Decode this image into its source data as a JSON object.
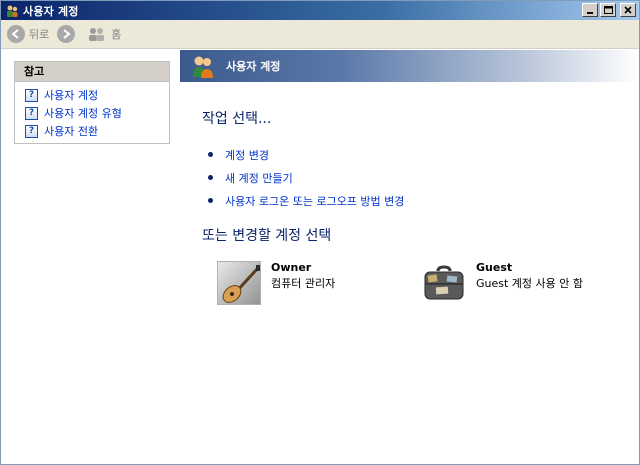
{
  "window": {
    "title": "사용자 계정"
  },
  "toolbar": {
    "back_label": "뒤로",
    "home_label": "홈"
  },
  "sidebar": {
    "panel_title": "참고",
    "links": [
      {
        "label": "사용자 계정"
      },
      {
        "label": "사용자 계정 유형"
      },
      {
        "label": "사용자 전환"
      }
    ]
  },
  "main": {
    "banner_title": "사용자 계정",
    "task_heading": "작업 선택...",
    "tasks": [
      {
        "label": "계정 변경"
      },
      {
        "label": "새 계정 만들기"
      },
      {
        "label": "사용자 로그온 또는 로그오프 방법 변경"
      }
    ],
    "account_heading": "또는 변경할 계정 선택",
    "accounts": [
      {
        "name": "Owner",
        "desc": "컴퓨터 관리자",
        "picture": "guitar-picture"
      },
      {
        "name": "Guest",
        "desc": "Guest 계정 사용 안 함",
        "picture": "suitcase-picture"
      }
    ]
  },
  "colors": {
    "title_bar": "#0a246a",
    "link": "#0033cc",
    "heading": "#0a246a",
    "panel_header": "#d4d0c8"
  }
}
